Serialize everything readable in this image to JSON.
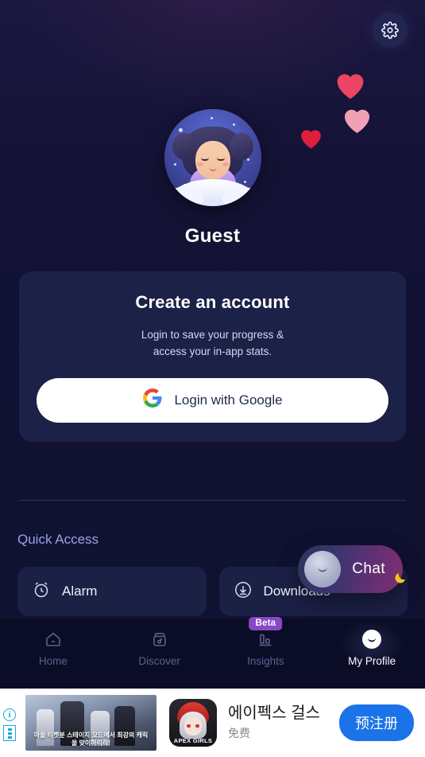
{
  "header": {
    "settings_icon": "gear-icon"
  },
  "profile": {
    "avatar_icon": "sleeping-girl-avatar",
    "name": "Guest",
    "hearts": [
      {
        "color": "#ec4464",
        "name": "heart-icon-1"
      },
      {
        "color": "#f2a0b8",
        "name": "heart-icon-2"
      },
      {
        "color": "#e01e3c",
        "name": "heart-icon-3"
      }
    ]
  },
  "account_card": {
    "title": "Create an account",
    "subtitle_line1": "Login to save your progress &",
    "subtitle_line2": "access your in-app stats.",
    "google_button": {
      "label": "Login with Google",
      "icon": "google-g-icon"
    }
  },
  "quick_access": {
    "title": "Quick Access",
    "items": [
      {
        "label": "Alarm",
        "icon": "alarm-clock-icon"
      },
      {
        "label": "Downloads",
        "icon": "download-circle-icon"
      }
    ]
  },
  "chat_fab": {
    "label": "Chat",
    "avatar_icon": "sleeping-face-icon",
    "moon_icon": "crescent-moon-icon",
    "moon_color": "#f5c518"
  },
  "bottom_nav": {
    "items": [
      {
        "label": "Home",
        "icon": "home-icon",
        "active": false
      },
      {
        "label": "Discover",
        "icon": "music-box-icon",
        "active": false
      },
      {
        "label": "Insights",
        "icon": "bar-chart-icon",
        "active": false,
        "badge": "Beta"
      },
      {
        "label": "My Profile",
        "icon": "profile-face-icon",
        "active": true
      }
    ]
  },
  "ad_banner": {
    "info_icon": "info-icon",
    "adchoices_icon": "adchoices-icon",
    "hero_icon": "game-artwork-image",
    "hero_caption": "마을 티켓분\n스테이지 모드에서 최강의 캐릭을 맞이하리라!",
    "app_icon": "apex-girls-app-icon",
    "app_icon_label": "APEX GIRLS",
    "title": "에이펙스 걸스",
    "price": "免费",
    "cta": "预注册",
    "cta_color": "#1a73e8"
  },
  "theme": {
    "background": "#111233",
    "card_background": "#1c2148",
    "accent_purple": "#8648c4",
    "text_primary": "#ffffff",
    "text_muted": "#5c6090",
    "quick_access_color": "#9aa3e6"
  }
}
